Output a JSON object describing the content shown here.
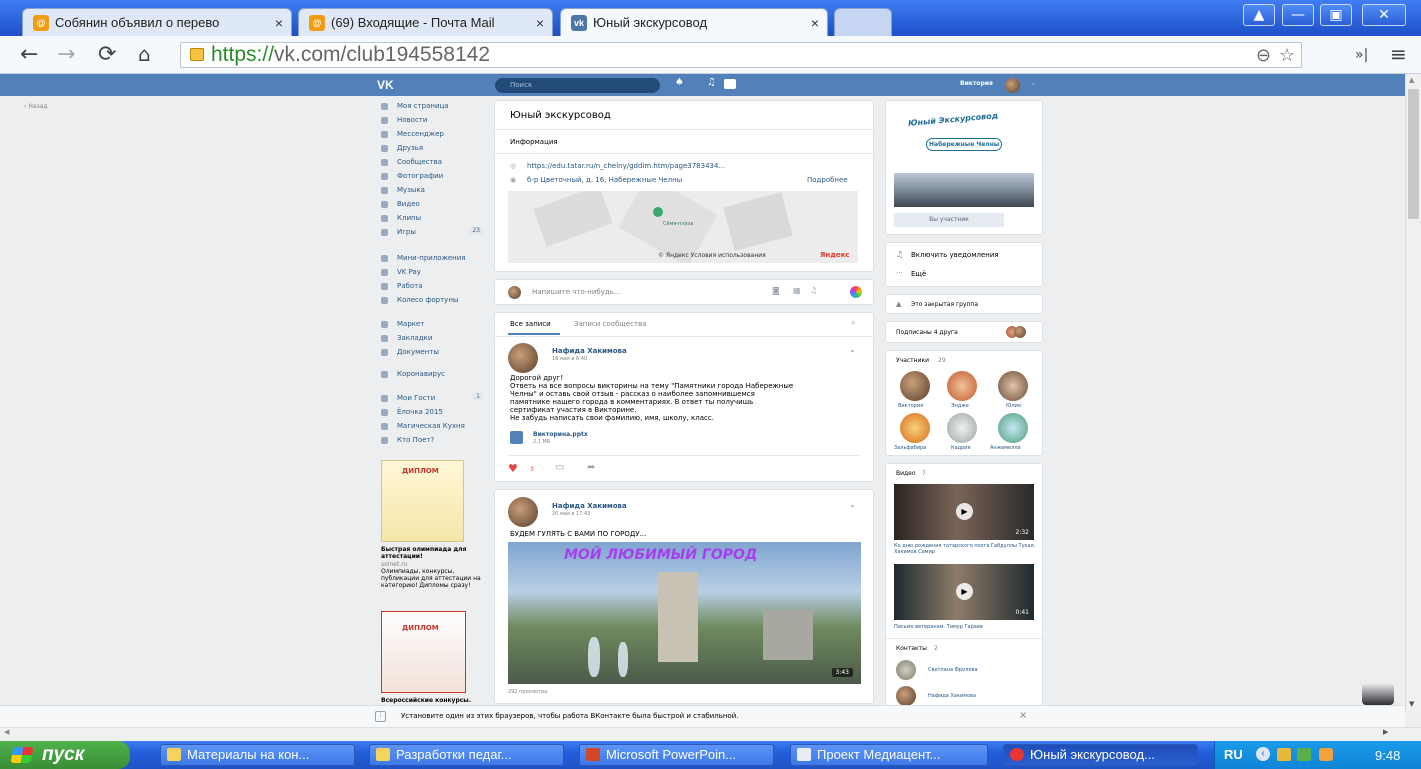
{
  "browser": {
    "tabs": [
      {
        "label": "Собянин объявил о перево",
        "favicon": "at-icon"
      },
      {
        "label": "(69) Входящие - Почта Mail",
        "favicon": "at-icon"
      },
      {
        "label": "Юный экскурсовод",
        "favicon": "vk-icon"
      }
    ],
    "tab_close": "×",
    "url_scheme": "https://",
    "url_rest": "vk.com/club194558142",
    "window_controls": [
      "▲",
      "—",
      "▣",
      "✕"
    ]
  },
  "vk": {
    "logo": "VK",
    "search_placeholder": "Поиск",
    "user_name": "Виктория",
    "back_link": "Назад",
    "menu": [
      {
        "label": "Моя страница",
        "icon": "home-icon"
      },
      {
        "label": "Новости",
        "icon": "news-icon"
      },
      {
        "label": "Мессенджер",
        "icon": "messenger-icon"
      },
      {
        "label": "Друзья",
        "icon": "friends-icon"
      },
      {
        "label": "Сообщества",
        "icon": "communities-icon"
      },
      {
        "label": "Фотографии",
        "icon": "photo-icon"
      },
      {
        "label": "Музыка",
        "icon": "music-icon"
      },
      {
        "label": "Видео",
        "icon": "video-icon"
      },
      {
        "label": "Клипы",
        "icon": "clips-icon"
      },
      {
        "label": "Игры",
        "icon": "games-icon",
        "badge": "23"
      }
    ],
    "menu2": [
      {
        "label": "Мини-приложения",
        "icon": "apps-icon"
      },
      {
        "label": "VK Pay",
        "icon": "vkpay-icon"
      },
      {
        "label": "Работа",
        "icon": "work-icon"
      },
      {
        "label": "Колесо фортуны",
        "icon": "wheel-icon"
      }
    ],
    "menu3": [
      {
        "label": "Маркет",
        "icon": "market-icon"
      },
      {
        "label": "Закладки",
        "icon": "bookmarks-icon"
      },
      {
        "label": "Документы",
        "icon": "documents-icon"
      }
    ],
    "menu4": [
      {
        "label": "Коронавирус",
        "icon": "virus-icon"
      }
    ],
    "menu5": [
      {
        "label": "Мои Гости",
        "icon": "app-icon",
        "badge": "1"
      },
      {
        "label": "Ёлочка 2015",
        "icon": "app-icon"
      },
      {
        "label": "Магическая Кухня",
        "icon": "app-icon"
      },
      {
        "label": "Кто Поет?",
        "icon": "app-icon"
      }
    ],
    "ad1": {
      "title": "Быстрая олимпиада для аттестации!",
      "domain": "solnet.ru",
      "text": "Олимпиады, конкурсы, публикации для аттестации на категорию! Дипломы сразу!",
      "image_text": "ДИПЛОМ"
    },
    "ad2": {
      "title": "Всероссийские конкурсы.",
      "image_text": "ДИПЛОМ"
    },
    "group": {
      "title": "Юный экскурсовод",
      "info_tab": "Информация",
      "link": "https://edu.tatar.ru/n_chelny/gddim.htm/page3783434...",
      "address": "б-р Цветочный, д. 16, Набережные Челны",
      "more": "Подробнее",
      "map_label": "Сёмя-плаза",
      "map_footer": "© Яндекс Условия использования",
      "map_brand": "Яндекс"
    },
    "composer": {
      "placeholder": "Напишите что-нибудь..."
    },
    "feed_tabs": [
      "Все записи",
      "Записи сообщества"
    ],
    "posts": [
      {
        "author": "Нафида Хакимова",
        "date": "18 мая в 8:40",
        "lines": [
          "Дорогой друг!",
          "Ответь на все вопросы викторины на тему \"Памятники города Набережные",
          "Челны\" и оставь свой отзыв - рассказ о наиболее запомнившемся",
          "памятнике нашего города в комментариях. В ответ ты получишь",
          "сертификат участия в Викторине.",
          "Не забудь написать свои фамилию, имя, школу, класс."
        ],
        "file_name": "Викторина.pptx",
        "file_size": "2,1 МБ",
        "likes": "3"
      },
      {
        "author": "Нафида Хакимова",
        "date": "20 мая в 17:43",
        "text": "БУДЕМ ГУЛЯТЬ С ВАМИ ПО ГОРОДУ...",
        "video_title": "МОЙ ЛЮБИМЫЙ ГОРОД",
        "video_duration": "3:43",
        "views": "292 просмотра"
      }
    ],
    "right": {
      "cover_title": "Юный Экскурсовод",
      "cover_subtitle": "Набережные Челны",
      "member_button": "Вы участник",
      "notify": "Включить уведомления",
      "more": "Ещё",
      "group_type": "Это закрытая группа",
      "friends_sub": "Подписаны 4 друга",
      "members_label": "Участники",
      "members_count": "29",
      "members": [
        "Виктория",
        "Эндже",
        "Юлия",
        "Зальфабира",
        "Кадрия",
        "Анжемелла"
      ],
      "videos_label": "Видео",
      "videos_count": "7",
      "videos": [
        {
          "title": "Ко дню рождения татарского поэта Габдуллы Тукая. Хакимов Самир",
          "duration": "2:32"
        },
        {
          "title": "Письмо ветеранам. Тимур Гараев",
          "duration": "0:41"
        }
      ],
      "contacts_label": "Контакты",
      "contacts_count": "2",
      "contacts": [
        "Светлана Фролова",
        "Нафида Хакимова"
      ]
    },
    "browser_notice": "Установите один из этих браузеров, чтобы работа ВКонтакте была быстрой и стабильной."
  },
  "taskbar": {
    "start": "пуск",
    "items": [
      {
        "label": "Материалы на кон...",
        "icon": "folder-icon"
      },
      {
        "label": "Разработки педаг...",
        "icon": "folder-icon"
      },
      {
        "label": "Microsoft PowerPoin...",
        "icon": "powerpoint-icon"
      },
      {
        "label": "Проект Медиацент...",
        "icon": "word-icon"
      },
      {
        "label": "Юный экскурсовод...",
        "icon": "opera-icon"
      }
    ],
    "lang": "RU",
    "time": "9:48"
  }
}
